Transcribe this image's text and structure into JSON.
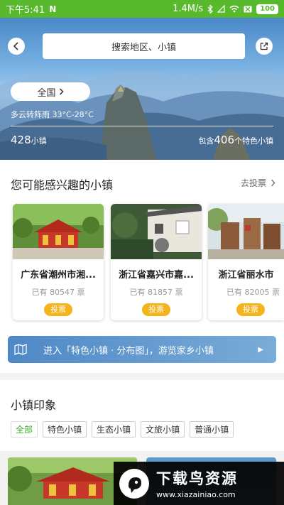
{
  "status_bar": {
    "time": "下午5:41",
    "network_speed": "1.4M/s",
    "battery": "100"
  },
  "hero": {
    "search_placeholder": "搜索地区、小镇",
    "region_label": "全国",
    "weather": "多云转阵雨 33°C-28°C",
    "town_count": "428",
    "town_unit": "小镇",
    "special_prefix": "包含",
    "special_count": "406",
    "special_suffix": "个特色小镇"
  },
  "interest": {
    "title": "您可能感兴趣的小镇",
    "vote_link": "去投票",
    "cards": [
      {
        "name": "广东省潮州市湘...",
        "votes": "已有 80547 票",
        "vote_label": "投票"
      },
      {
        "name": "浙江省嘉兴市嘉...",
        "votes": "已有 81857 票",
        "vote_label": "投票"
      },
      {
        "name": "浙江省丽水市",
        "votes": "已有 82005 票",
        "vote_label": "投票"
      }
    ]
  },
  "map_banner": {
    "text": "进入「特色小镇 · 分布图」，游览家乡小镇"
  },
  "impressions": {
    "title": "小镇印象",
    "tags": [
      "全部",
      "特色小镇",
      "生态小镇",
      "文旅小镇",
      "普通小镇"
    ]
  },
  "watermark": {
    "title": "下载鸟资源",
    "url": "www.xiazainiao.com"
  },
  "colors": {
    "status_green": "#58b92d",
    "vote_yellow": "#f5b41b",
    "tag_active_green": "#3fae2a",
    "banner_blue": "#4e88c6"
  }
}
